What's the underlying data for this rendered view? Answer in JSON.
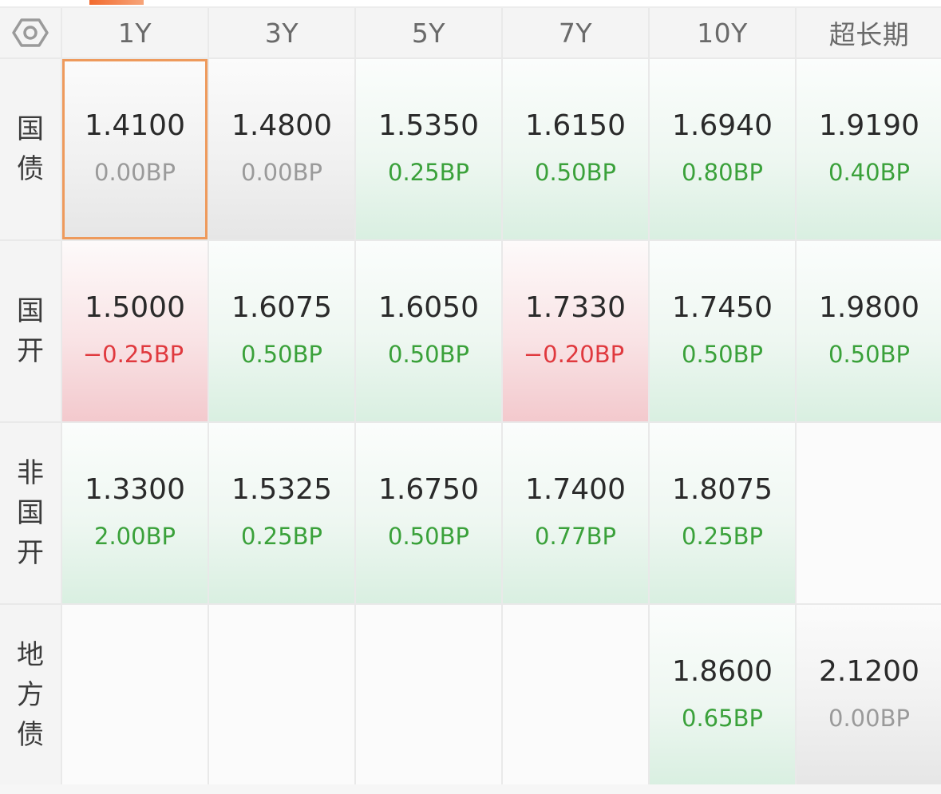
{
  "colors": {
    "up": "#3aa13a",
    "down": "#e0393e",
    "flat": "#9a9a9a",
    "selected_border": "#ee9a5c",
    "accent": "#f26a2e"
  },
  "corner_icon": "hexagon-settings-icon",
  "columns": [
    "1Y",
    "3Y",
    "5Y",
    "7Y",
    "10Y",
    "超长期"
  ],
  "rows": [
    {
      "label": [
        "国",
        "债"
      ],
      "cells": [
        {
          "yield": "1.4100",
          "change": "0.00BP",
          "trend": "flat",
          "selected": true
        },
        {
          "yield": "1.4800",
          "change": "0.00BP",
          "trend": "flat"
        },
        {
          "yield": "1.5350",
          "change": "0.25BP",
          "trend": "up"
        },
        {
          "yield": "1.6150",
          "change": "0.50BP",
          "trend": "up"
        },
        {
          "yield": "1.6940",
          "change": "0.80BP",
          "trend": "up"
        },
        {
          "yield": "1.9190",
          "change": "0.40BP",
          "trend": "up"
        }
      ]
    },
    {
      "label": [
        "国",
        "开"
      ],
      "cells": [
        {
          "yield": "1.5000",
          "change": "−0.25BP",
          "trend": "down"
        },
        {
          "yield": "1.6075",
          "change": "0.50BP",
          "trend": "up"
        },
        {
          "yield": "1.6050",
          "change": "0.50BP",
          "trend": "up"
        },
        {
          "yield": "1.7330",
          "change": "−0.20BP",
          "trend": "down"
        },
        {
          "yield": "1.7450",
          "change": "0.50BP",
          "trend": "up"
        },
        {
          "yield": "1.9800",
          "change": "0.50BP",
          "trend": "up"
        }
      ]
    },
    {
      "label": [
        "非",
        "国",
        "开"
      ],
      "cells": [
        {
          "yield": "1.3300",
          "change": "2.00BP",
          "trend": "up"
        },
        {
          "yield": "1.5325",
          "change": "0.25BP",
          "trend": "up"
        },
        {
          "yield": "1.6750",
          "change": "0.50BP",
          "trend": "up"
        },
        {
          "yield": "1.7400",
          "change": "0.77BP",
          "trend": "up"
        },
        {
          "yield": "1.8075",
          "change": "0.25BP",
          "trend": "up"
        },
        {
          "yield": "",
          "change": "",
          "trend": "empty"
        }
      ]
    },
    {
      "label": [
        "地",
        "方",
        "债"
      ],
      "cells": [
        {
          "yield": "",
          "change": "",
          "trend": "empty"
        },
        {
          "yield": "",
          "change": "",
          "trend": "empty"
        },
        {
          "yield": "",
          "change": "",
          "trend": "empty"
        },
        {
          "yield": "",
          "change": "",
          "trend": "empty"
        },
        {
          "yield": "1.8600",
          "change": "0.65BP",
          "trend": "up"
        },
        {
          "yield": "2.1200",
          "change": "0.00BP",
          "trend": "flat"
        }
      ]
    }
  ]
}
